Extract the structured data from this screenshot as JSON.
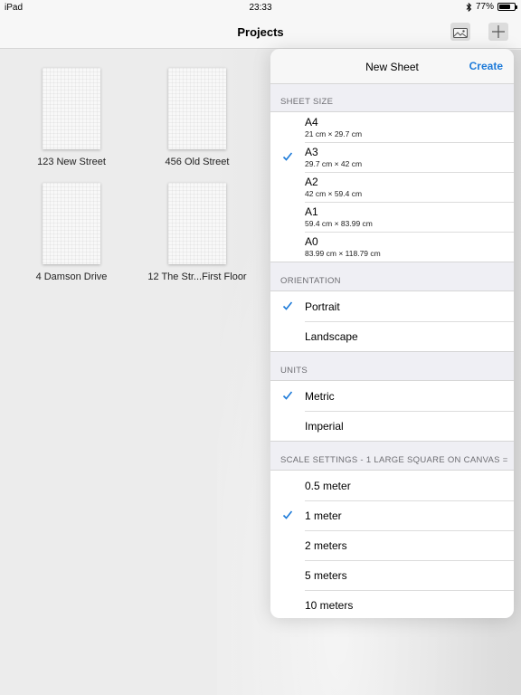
{
  "status": {
    "device": "iPad",
    "time": "23:33",
    "battery": "77%",
    "battery_level": 0.77
  },
  "nav": {
    "title": "Projects",
    "photo_icon": "photo-folder-icon",
    "add_icon": "plus-icon"
  },
  "projects": [
    {
      "label": "123 New Street"
    },
    {
      "label": "456 Old Street"
    },
    {
      "label": "4 Damson Drive"
    },
    {
      "label": "12 The Str...First Floor"
    }
  ],
  "popover": {
    "title": "New Sheet",
    "create_label": "Create",
    "accent": "#1e7bd9",
    "sheet_size": {
      "header": "SHEET SIZE",
      "items": [
        {
          "label": "A4",
          "sub": "21 cm × 29.7 cm",
          "checked": false
        },
        {
          "label": "A3",
          "sub": "29.7 cm × 42 cm",
          "checked": true
        },
        {
          "label": "A2",
          "sub": "42 cm × 59.4 cm",
          "checked": false
        },
        {
          "label": "A1",
          "sub": "59.4 cm × 83.99 cm",
          "checked": false
        },
        {
          "label": "A0",
          "sub": "83.99 cm × 118.79 cm",
          "checked": false
        }
      ]
    },
    "orientation": {
      "header": "ORIENTATION",
      "items": [
        {
          "label": "Portrait",
          "checked": true
        },
        {
          "label": "Landscape",
          "checked": false
        }
      ]
    },
    "units": {
      "header": "UNITS",
      "items": [
        {
          "label": "Metric",
          "checked": true
        },
        {
          "label": "Imperial",
          "checked": false
        }
      ]
    },
    "scale": {
      "header": "SCALE SETTINGS - 1 LARGE SQUARE ON CANVAS =",
      "items": [
        {
          "label": "0.5 meter",
          "checked": false
        },
        {
          "label": "1 meter",
          "checked": true
        },
        {
          "label": "2 meters",
          "checked": false
        },
        {
          "label": "5 meters",
          "checked": false
        },
        {
          "label": "10 meters",
          "checked": false
        }
      ]
    }
  }
}
